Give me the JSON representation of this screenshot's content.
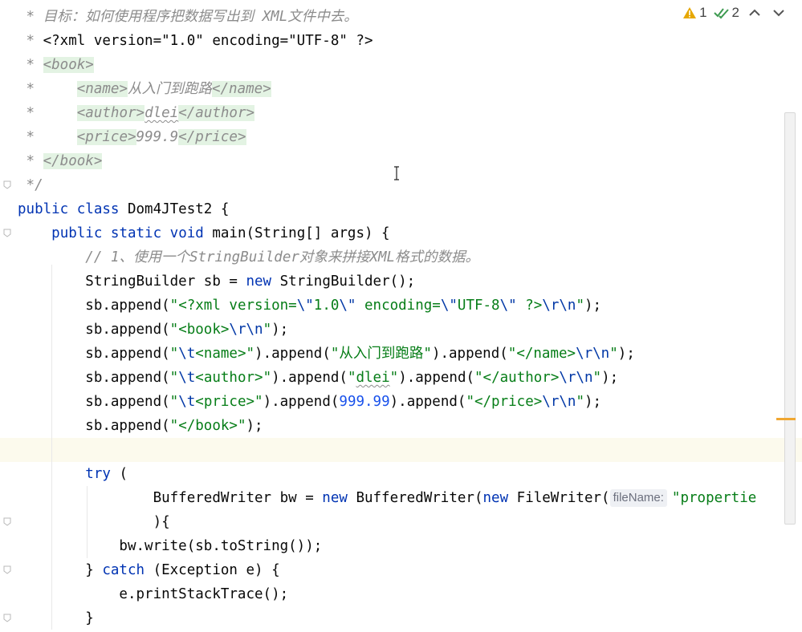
{
  "editor": {
    "lines": [
      {
        "tokens": [
          {
            "t": " * ",
            "c": "cmt"
          },
          {
            "t": "目标：如何使用程序把数据写出到 XML文件中去。",
            "c": "cmt"
          }
        ]
      },
      {
        "tokens": [
          {
            "t": " * ",
            "c": "cmt"
          },
          {
            "t": "<?xml version=\"1.0\" encoding=\"UTF-8\" ?>",
            "c": ""
          }
        ]
      },
      {
        "tokens": [
          {
            "t": " * ",
            "c": "cmt"
          },
          {
            "t": "<book>",
            "c": "tag"
          }
        ]
      },
      {
        "tokens": [
          {
            "t": " *     ",
            "c": "cmt"
          },
          {
            "t": "<name>",
            "c": "tag"
          },
          {
            "t": "从入门到跑路",
            "c": "cmt"
          },
          {
            "t": "</name>",
            "c": "tag"
          }
        ]
      },
      {
        "tokens": [
          {
            "t": " *     ",
            "c": "cmt"
          },
          {
            "t": "<author>",
            "c": "tag"
          },
          {
            "t": "dlei",
            "c": "cmt wavy"
          },
          {
            "t": "</author>",
            "c": "tag"
          }
        ]
      },
      {
        "tokens": [
          {
            "t": " *     ",
            "c": "cmt"
          },
          {
            "t": "<price>",
            "c": "tag"
          },
          {
            "t": "999.9",
            "c": "cmt"
          },
          {
            "t": "</price>",
            "c": "tag"
          }
        ]
      },
      {
        "tokens": [
          {
            "t": " * ",
            "c": "cmt"
          },
          {
            "t": "</book>",
            "c": "tag"
          }
        ]
      },
      {
        "fold": true,
        "tokens": [
          {
            "t": " */",
            "c": "cmt"
          }
        ]
      },
      {
        "tokens": [
          {
            "t": "public class ",
            "c": "kw"
          },
          {
            "t": "Dom4JTest2 {",
            "c": ""
          }
        ]
      },
      {
        "fold": true,
        "tokens": [
          {
            "t": "    ",
            "c": ""
          },
          {
            "t": "public static void ",
            "c": "kw"
          },
          {
            "t": "main(String[] args) {",
            "c": ""
          }
        ]
      },
      {
        "tokens": [
          {
            "t": "        ",
            "c": ""
          },
          {
            "t": "// 1、使用一个StringBuilder对象来拼接XML格式的数据。",
            "c": "cmt"
          }
        ]
      },
      {
        "tokens": [
          {
            "t": "        StringBuilder sb = ",
            "c": ""
          },
          {
            "t": "new ",
            "c": "kw"
          },
          {
            "t": "StringBuilder();",
            "c": ""
          }
        ]
      },
      {
        "tokens": [
          {
            "t": "        sb.append(",
            "c": ""
          },
          {
            "t": "\"<?xml version=",
            "c": "str"
          },
          {
            "t": "\\\"",
            "c": "esc"
          },
          {
            "t": "1.0",
            "c": "str"
          },
          {
            "t": "\\\"",
            "c": "esc"
          },
          {
            "t": " encoding=",
            "c": "str"
          },
          {
            "t": "\\\"",
            "c": "esc"
          },
          {
            "t": "UTF-8",
            "c": "str"
          },
          {
            "t": "\\\"",
            "c": "esc"
          },
          {
            "t": " ?>",
            "c": "str"
          },
          {
            "t": "\\r\\n",
            "c": "esc"
          },
          {
            "t": "\"",
            "c": "str"
          },
          {
            "t": ");",
            "c": ""
          }
        ]
      },
      {
        "tokens": [
          {
            "t": "        sb.append(",
            "c": ""
          },
          {
            "t": "\"<book>",
            "c": "str"
          },
          {
            "t": "\\r\\n",
            "c": "esc"
          },
          {
            "t": "\"",
            "c": "str"
          },
          {
            "t": ");",
            "c": ""
          }
        ]
      },
      {
        "tokens": [
          {
            "t": "        sb.append(",
            "c": ""
          },
          {
            "t": "\"",
            "c": "str"
          },
          {
            "t": "\\t",
            "c": "esc"
          },
          {
            "t": "<name>\"",
            "c": "str"
          },
          {
            "t": ").append(",
            "c": ""
          },
          {
            "t": "\"从入门到跑路\"",
            "c": "str"
          },
          {
            "t": ").append(",
            "c": ""
          },
          {
            "t": "\"</name>",
            "c": "str"
          },
          {
            "t": "\\r\\n",
            "c": "esc"
          },
          {
            "t": "\"",
            "c": "str"
          },
          {
            "t": ");",
            "c": ""
          }
        ]
      },
      {
        "tokens": [
          {
            "t": "        sb.append(",
            "c": ""
          },
          {
            "t": "\"",
            "c": "str"
          },
          {
            "t": "\\t",
            "c": "esc"
          },
          {
            "t": "<author>\"",
            "c": "str"
          },
          {
            "t": ").append(",
            "c": ""
          },
          {
            "t": "\"",
            "c": "str"
          },
          {
            "t": "dlei",
            "c": "str wavy"
          },
          {
            "t": "\"",
            "c": "str"
          },
          {
            "t": ").append(",
            "c": ""
          },
          {
            "t": "\"</author>",
            "c": "str"
          },
          {
            "t": "\\r\\n",
            "c": "esc"
          },
          {
            "t": "\"",
            "c": "str"
          },
          {
            "t": ");",
            "c": ""
          }
        ]
      },
      {
        "tokens": [
          {
            "t": "        sb.append(",
            "c": ""
          },
          {
            "t": "\"",
            "c": "str"
          },
          {
            "t": "\\t",
            "c": "esc"
          },
          {
            "t": "<price>\"",
            "c": "str"
          },
          {
            "t": ").append(",
            "c": ""
          },
          {
            "t": "999.99",
            "c": "num"
          },
          {
            "t": ").append(",
            "c": ""
          },
          {
            "t": "\"</price>",
            "c": "str"
          },
          {
            "t": "\\r\\n",
            "c": "esc"
          },
          {
            "t": "\"",
            "c": "str"
          },
          {
            "t": ");",
            "c": ""
          }
        ]
      },
      {
        "tokens": [
          {
            "t": "        sb.append(",
            "c": ""
          },
          {
            "t": "\"</book>\"",
            "c": "str"
          },
          {
            "t": ");",
            "c": ""
          }
        ]
      },
      {
        "current": true,
        "tokens": []
      },
      {
        "tokens": [
          {
            "t": "        ",
            "c": ""
          },
          {
            "t": "try ",
            "c": "kw"
          },
          {
            "t": "(",
            "c": ""
          }
        ]
      },
      {
        "tokens": [
          {
            "t": "                BufferedWriter bw = ",
            "c": ""
          },
          {
            "t": "new ",
            "c": "kw"
          },
          {
            "t": "BufferedWriter(",
            "c": ""
          },
          {
            "t": "new ",
            "c": "kw"
          },
          {
            "t": "FileWriter(",
            "c": ""
          },
          {
            "t": "fileName:",
            "c": "hint"
          },
          {
            "t": "\"propertie",
            "c": "str"
          }
        ]
      },
      {
        "fold": true,
        "tokens": [
          {
            "t": "                ){",
            "c": ""
          }
        ]
      },
      {
        "tokens": [
          {
            "t": "            bw.write(sb.toString());",
            "c": ""
          }
        ]
      },
      {
        "fold": true,
        "tokens": [
          {
            "t": "        } ",
            "c": ""
          },
          {
            "t": "catch ",
            "c": "kw"
          },
          {
            "t": "(Exception e) {",
            "c": ""
          }
        ]
      },
      {
        "tokens": [
          {
            "t": "            e.printStackTrace();",
            "c": ""
          }
        ]
      },
      {
        "fold": true,
        "tokens": [
          {
            "t": "        }",
            "c": ""
          }
        ]
      }
    ]
  },
  "inspections": {
    "warnings_count": "1",
    "weak_warnings_count": "2",
    "warning_icon": "warning-triangle-icon",
    "weak_warning_icon": "double-check-icon",
    "prev_icon": "chevron-up-icon",
    "next_icon": "chevron-down-icon"
  },
  "colors": {
    "keyword": "#0033b3",
    "string": "#067d17",
    "comment": "#8c8c8c",
    "number": "#1750eb",
    "xml_tag_bg": "#e3f3e3",
    "current_line_bg": "#fcfaed",
    "warning": "#e6a700",
    "weak_warning": "#3d9a50",
    "error_stripe_marker": "#f0a732"
  }
}
